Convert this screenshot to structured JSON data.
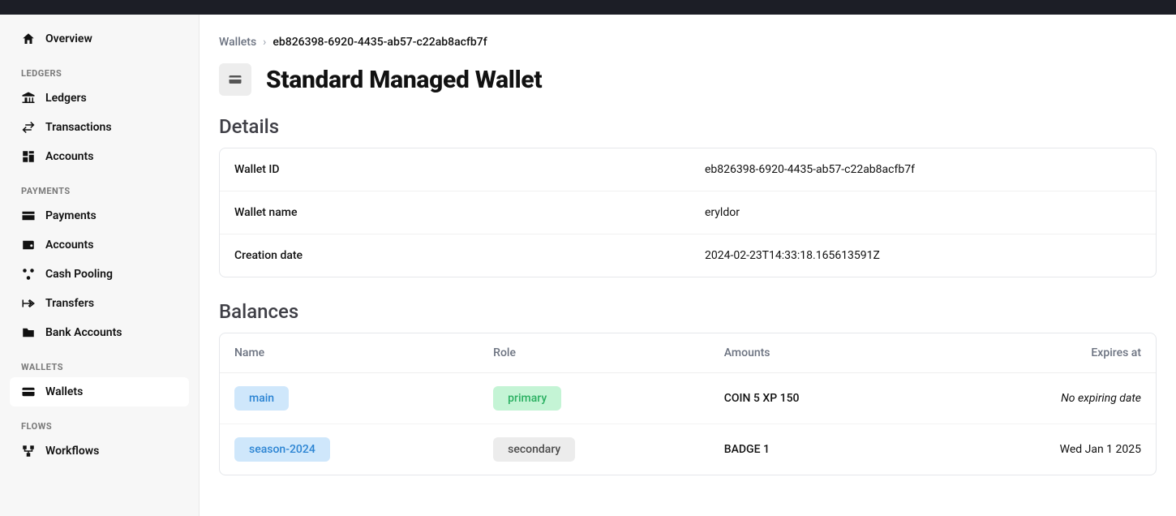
{
  "sidebar": {
    "overview": "Overview",
    "sections": {
      "ledgers": {
        "label": "LEDGERS",
        "items": [
          "Ledgers",
          "Transactions",
          "Accounts"
        ]
      },
      "payments": {
        "label": "PAYMENTS",
        "items": [
          "Payments",
          "Accounts",
          "Cash Pooling",
          "Transfers",
          "Bank Accounts"
        ]
      },
      "wallets": {
        "label": "WALLETS",
        "items": [
          "Wallets"
        ]
      },
      "flows": {
        "label": "FLOWS",
        "items": [
          "Workflows"
        ]
      }
    }
  },
  "breadcrumb": {
    "root": "Wallets",
    "sep": "›",
    "current": "eb826398-6920-4435-ab57-c22ab8acfb7f"
  },
  "title": "Standard Managed Wallet",
  "details": {
    "heading": "Details",
    "rows": [
      {
        "key": "Wallet ID",
        "value": "eb826398-6920-4435-ab57-c22ab8acfb7f"
      },
      {
        "key": "Wallet name",
        "value": "eryldor"
      },
      {
        "key": "Creation date",
        "value": "2024-02-23T14:33:18.165613591Z"
      }
    ]
  },
  "balances": {
    "heading": "Balances",
    "columns": [
      "Name",
      "Role",
      "Amounts",
      "Expires at"
    ],
    "rows": [
      {
        "name": "main",
        "role": "primary",
        "role_variant": "green",
        "amounts": "COIN 5 XP 150",
        "expires": "No expiring date",
        "expires_italic": true
      },
      {
        "name": "season-2024",
        "role": "secondary",
        "role_variant": "gray",
        "amounts": "BADGE 1",
        "expires": "Wed Jan 1 2025",
        "expires_italic": false
      }
    ]
  }
}
